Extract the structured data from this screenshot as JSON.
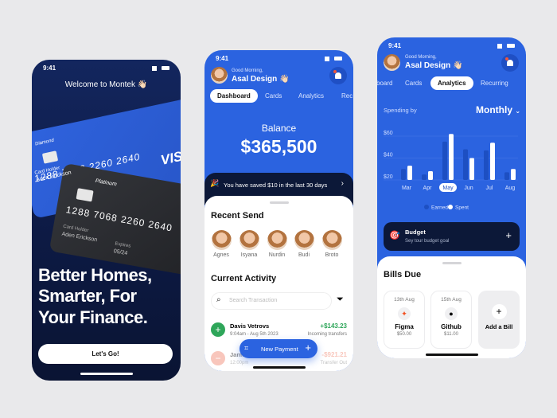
{
  "status_time": "9:41",
  "welcome": {
    "title": "Welcome to Montek 👋🏻",
    "card_blue": {
      "tier": "Diamond",
      "number": "1288 7068 2260 2640",
      "holder_label": "Card Holder",
      "holder": "Aden Erickson",
      "brand": "VISA"
    },
    "card_dark": {
      "tier": "Platinum",
      "number": "1288 7068 2260 2640",
      "holder_label": "Card Holder",
      "holder": "Aden Erickson",
      "expires_label": "Expires",
      "expires": "05/24"
    },
    "headline": "Better Homes, Smarter, For Your Finance.",
    "cta": "Let's Go!"
  },
  "dashboard": {
    "greeting": "Good Morning,",
    "user": "Asal Design 👋🏻",
    "tabs": [
      "Dashboard",
      "Cards",
      "Analytics",
      "Rec"
    ],
    "balance_label": "Balance",
    "balance": "$365,500",
    "savings_banner": "You have saved $10 in the last 30 days",
    "recent_send_title": "Recent Send",
    "recent": [
      "Agnes",
      "Isyana",
      "Nurdin",
      "Budi",
      "Broto"
    ],
    "activity_title": "Current Activity",
    "search_placeholder": "Search Transaction",
    "transactions": [
      {
        "name": "Davis Vetrovs",
        "time": "9:04am - Aug 5th 2023",
        "amount": "+$143.23",
        "type": "Incoming transfers"
      },
      {
        "name": "James",
        "time": "12:00pm",
        "amount": "-$921.21",
        "type": "Transfer Out"
      }
    ],
    "new_payment": "New Payment",
    "colors": {
      "positive": "#2fa65a",
      "negative": "#f0806a"
    }
  },
  "analytics": {
    "greeting": "Good Morning,",
    "user": "Asal Design 👋🏻",
    "tabs": [
      "board",
      "Cards",
      "Analytics",
      "Recurring"
    ],
    "spending_by": "Spending by",
    "period": "Monthly",
    "budget_title": "Budget",
    "budget_sub": "Sey tour budget goal",
    "bills_title": "Bills Due",
    "bills": [
      {
        "date": "13th Aug",
        "name": "Figma",
        "amount": "$50.00"
      },
      {
        "date": "15th Aug",
        "name": "Github",
        "amount": "$11.00"
      }
    ],
    "add_bill": "Add a Bill"
  },
  "chart_data": {
    "type": "bar",
    "categories": [
      "Mar",
      "Apr",
      "May",
      "Jun",
      "Jul",
      "Aug"
    ],
    "selected": "May",
    "series": [
      {
        "name": "Earned",
        "values": [
          30,
          25,
          55,
          48,
          47,
          27
        ],
        "color": "#1d4fc2"
      },
      {
        "name": "Spent",
        "values": [
          33,
          28,
          62,
          40,
          54,
          30
        ],
        "color": "#ffffff"
      }
    ],
    "y_ticks": [
      "$60",
      "$40",
      "$20"
    ],
    "ylim": [
      20,
      65
    ],
    "grid": true,
    "legend": "bottom"
  }
}
